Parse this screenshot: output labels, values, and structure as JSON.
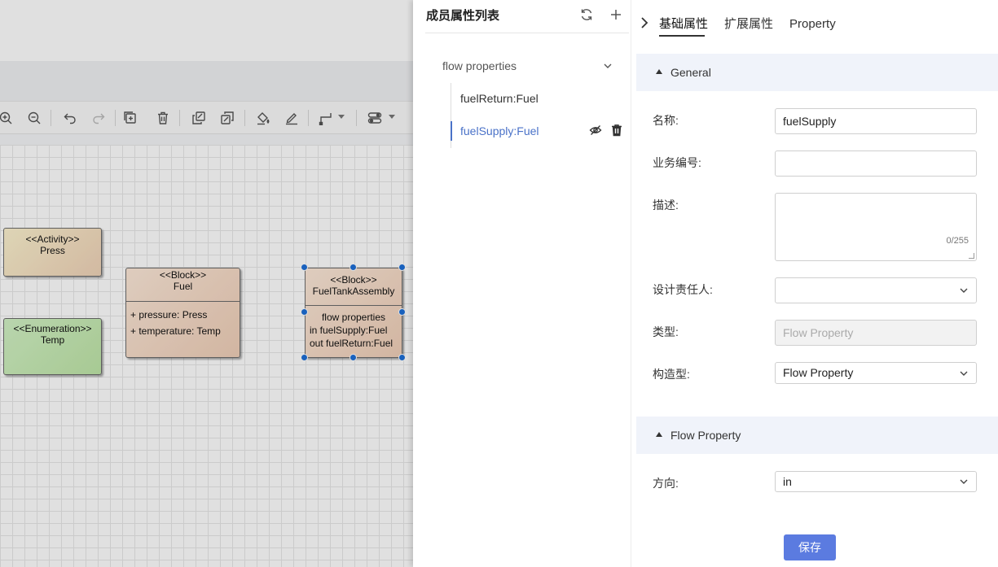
{
  "diagram": {
    "nodes": [
      {
        "stereotype": "<<Activity>>",
        "name": "Press"
      },
      {
        "stereotype": "<<Enumeration>>",
        "name": "Temp"
      },
      {
        "stereotype": "<<Block>>",
        "name": "Fuel",
        "attributes": [
          "+ pressure: Press",
          "+ temperature: Temp"
        ]
      },
      {
        "stereotype": "<<Block>>",
        "name": "FuelTankAssembly",
        "compartment_title": "flow properties",
        "lines": [
          "in fuelSupply:Fuel",
          "out fuelReturn:Fuel"
        ]
      }
    ],
    "toolbar_icons": [
      "zoom-in-icon",
      "zoom-out-icon",
      "undo-icon",
      "redo-icon",
      "add-frame-icon",
      "delete-icon",
      "copy-style-icon",
      "paste-style-icon",
      "fill-color-icon",
      "line-color-icon",
      "connector-style-icon",
      "toggle-icon"
    ]
  },
  "member_list": {
    "title": "成员属性列表",
    "group": {
      "label": "flow properties",
      "expanded": true
    },
    "items": [
      {
        "label": "fuelReturn:Fuel",
        "selected": false
      },
      {
        "label": "fuelSupply:Fuel",
        "selected": true
      }
    ]
  },
  "properties": {
    "tabs": [
      {
        "label": "基础属性",
        "active": true
      },
      {
        "label": "扩展属性",
        "active": false
      },
      {
        "label": "Property",
        "active": false
      }
    ],
    "general": {
      "title": "General",
      "fields": {
        "name": {
          "label": "名称:",
          "value": "fuelSupply"
        },
        "code": {
          "label": "业务编号:",
          "value": ""
        },
        "desc": {
          "label": "描述:",
          "value": "",
          "counter": "0/255"
        },
        "owner": {
          "label": "设计责任人:",
          "value": ""
        },
        "type": {
          "label": "类型:",
          "placeholder": "Flow Property"
        },
        "stereotype": {
          "label": "构造型:",
          "value": "Flow Property"
        }
      }
    },
    "flow": {
      "title": "Flow Property",
      "direction": {
        "label": "方向:",
        "value": "in"
      }
    },
    "save_label": "保存"
  },
  "colors": {
    "accent": "#5b7be0",
    "selected_text": "#4a72c8",
    "section_bg": "#f0f3fa",
    "handle": "#1d6fd8"
  }
}
